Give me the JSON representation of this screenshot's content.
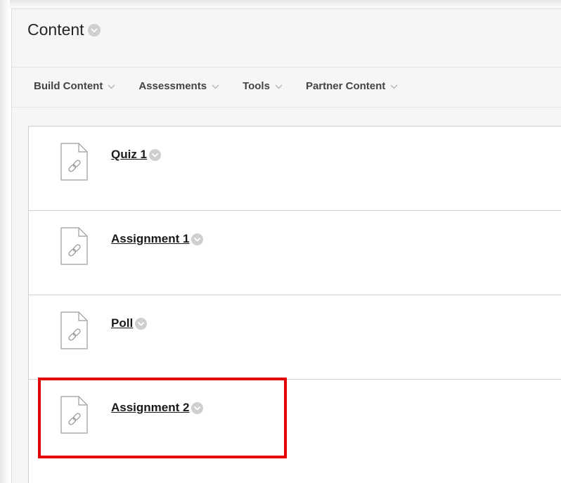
{
  "page": {
    "title": "Content"
  },
  "toolbar": {
    "menus": [
      {
        "label": "Build Content"
      },
      {
        "label": "Assessments"
      },
      {
        "label": "Tools"
      },
      {
        "label": "Partner Content"
      }
    ]
  },
  "content_items": [
    {
      "title": "Quiz 1"
    },
    {
      "title": "Assignment 1"
    },
    {
      "title": "Poll"
    },
    {
      "title": "Assignment 2"
    }
  ],
  "annotation": {
    "highlight_color": "#e30000",
    "highlighted_item": "Assignment 2"
  },
  "icons": {
    "content_item": "link-file-icon",
    "context_menu": "chevron-circle-icon"
  }
}
